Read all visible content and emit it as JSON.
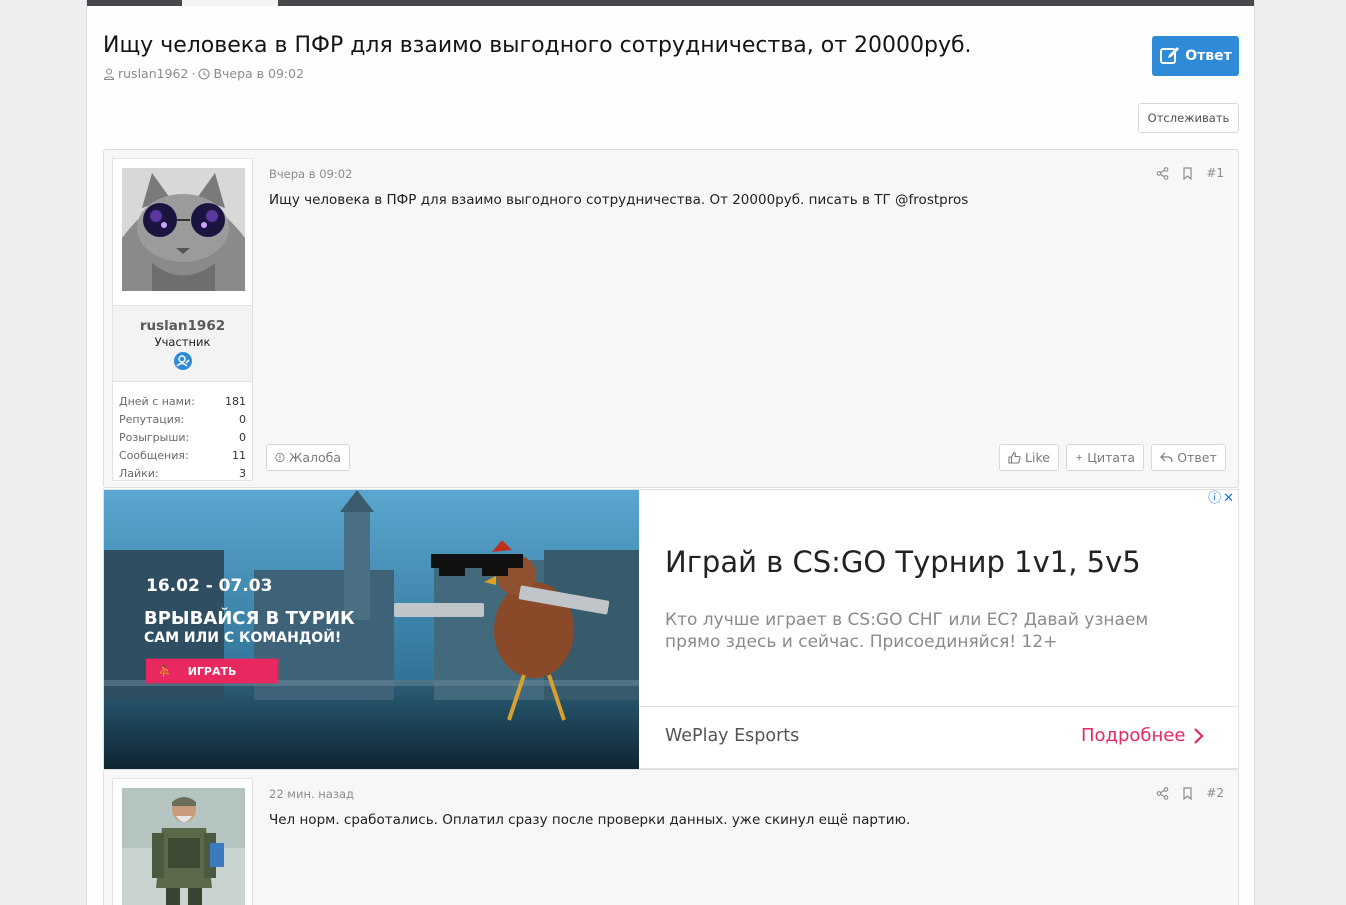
{
  "thread": {
    "title": "Ищу человека в ПФР для взаимо выгодного сотрудничества, от 20000руб.",
    "author": "ruslan1962",
    "separator": "·",
    "date": "Вчера в 09:02",
    "reply_label": "Ответ",
    "watch_label": "Отслеживать"
  },
  "posts": [
    {
      "date": "Вчера в 09:02",
      "number": "#1",
      "text": "Ищу человека в ПФР для взаимо выгодного сотрудничества. От 20000руб. писать в ТГ @frostpros",
      "user": {
        "name": "ruslan1962",
        "title": "Участник",
        "stats": [
          {
            "label": "Дней с нами:",
            "value": "181"
          },
          {
            "label": "Репутация:",
            "value": "0"
          },
          {
            "label": "Розыгрыши:",
            "value": "0"
          },
          {
            "label": "Сообщения:",
            "value": "11"
          },
          {
            "label": "Лайки:",
            "value": "3"
          }
        ]
      },
      "report_label": "Жалоба",
      "like_label": "Like",
      "quote_label": "Цитата",
      "reply_label": "Ответ"
    },
    {
      "date": "22 мин. назад",
      "number": "#2",
      "text": "Чел норм. сработались. Оплатил сразу после проверки данных. уже скинул ещё партию."
    }
  ],
  "ad": {
    "dates": "16.02 - 07.03",
    "line1": "ВРЫВАЙСЯ В ТУРИК",
    "line2": "САМ ИЛИ С КОМАНДОЙ!",
    "play_label": "ИГРАТЬ",
    "headline": "Играй в CS:GO Турнир 1v1, 5v5",
    "description": "Кто лучше играет в CS:GO СНГ или ЕС? Давай узнаем прямо здесь и сейчас. Присоединяйся! 12+",
    "brand": "WePlay Esports",
    "cta": "Подробнее",
    "info_glyph": "ⓘ",
    "close_glyph": "✕",
    "accent_color": "#e8285f"
  },
  "colors": {
    "primary_button": "#2f8ad8",
    "topbar": "#47494d"
  }
}
